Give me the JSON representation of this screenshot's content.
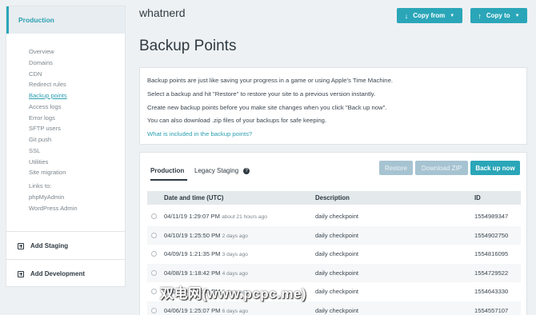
{
  "sidebar": {
    "environment": "Production",
    "nav": [
      "Overview",
      "Domains",
      "CDN",
      "Redirect rules",
      "Backup points",
      "Access logs",
      "Error logs",
      "SFTP users",
      "Git push",
      "SSL",
      "Utilities",
      "Site migration"
    ],
    "links_label": "Links to:",
    "links": [
      "phpMyAdmin",
      "WordPress Admin"
    ],
    "add_staging": "Add Staging",
    "add_development": "Add Development"
  },
  "header": {
    "site_name": "whatnerd",
    "copy_from": "Copy from",
    "copy_to": "Copy to"
  },
  "page_title": "Backup Points",
  "info": {
    "lines": [
      "Backup points are just like saving your progress in a game or using Apple's Time Machine.",
      "Select a backup and hit \"Restore\" to restore your site to a previous version instantly.",
      "Create new backup points before you make site changes when you click \"Back up now\".",
      "You can also download .zip files of your backups for safe keeping."
    ],
    "link": "What is included in the backup points?"
  },
  "tabs": {
    "production": "Production",
    "legacy": "Legacy Staging",
    "help_glyph": "?"
  },
  "actions": {
    "restore": "Restore",
    "download_zip": "Download ZIP",
    "back_up_now": "Back up now"
  },
  "table": {
    "headers": [
      "Date and time (UTC)",
      "Description",
      "ID"
    ],
    "rows": [
      {
        "date": "04/11/19 1:29:07 PM",
        "relative": "about 21 hours ago",
        "description": "daily checkpoint",
        "id": "1554989347"
      },
      {
        "date": "04/10/19 1:25:50 PM",
        "relative": "2 days ago",
        "description": "daily checkpoint",
        "id": "1554902750"
      },
      {
        "date": "04/09/19 1:21:35 PM",
        "relative": "3 days ago",
        "description": "daily checkpoint",
        "id": "1554816095"
      },
      {
        "date": "04/08/19 1:18:42 PM",
        "relative": "4 days ago",
        "description": "daily checkpoint",
        "id": "1554729522"
      },
      {
        "date": "04/07/19 1:22:10 PM",
        "relative": "5 days ago",
        "description": "daily checkpoint",
        "id": "1554643330"
      },
      {
        "date": "04/06/19 1:25:07 PM",
        "relative": "6 days ago",
        "description": "daily checkpoint",
        "id": "1554557107"
      }
    ]
  },
  "watermark": "双电网(www.pcpc.me)",
  "colors": {
    "accent": "#2aa6b8",
    "disabled": "#a6c3d1",
    "text": "#3b4650"
  }
}
